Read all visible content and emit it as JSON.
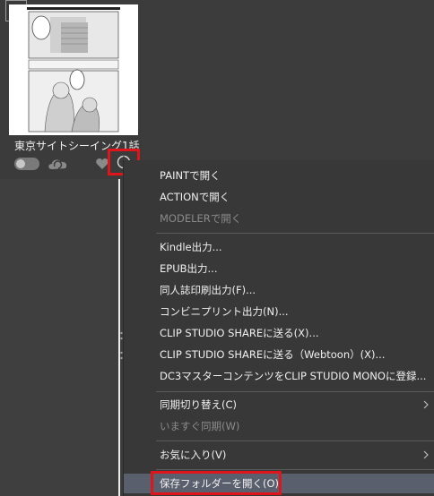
{
  "card": {
    "title": "東京サイトシーイング1話目"
  },
  "menu": {
    "items": [
      {
        "label": "PAINTで開く",
        "enabled": true
      },
      {
        "label": "ACTIONで開く",
        "enabled": true
      },
      {
        "label": "MODELERで開く",
        "enabled": false
      },
      {
        "label": "Kindle出力...",
        "enabled": true
      },
      {
        "label": "EPUB出力...",
        "enabled": true
      },
      {
        "label": "同人誌印刷出力(F)...",
        "enabled": true
      },
      {
        "label": "コンビニプリント出力(N)...",
        "enabled": true
      },
      {
        "label": "CLIP STUDIO SHAREに送る(X)...",
        "enabled": true
      },
      {
        "label": "CLIP STUDIO SHAREに送る（Webtoon）(X)...",
        "enabled": true
      },
      {
        "label": "DC3マスターコンテンツをCLIP STUDIO MONOに登録...",
        "enabled": true
      },
      {
        "label": "同期切り替え(C)",
        "enabled": true,
        "submenu": true
      },
      {
        "label": "いますぐ同期(W)",
        "enabled": false
      },
      {
        "label": "お気に入り(V)",
        "enabled": true,
        "submenu": true
      },
      {
        "label": "保存フォルダーを開く(O)",
        "enabled": true,
        "highlighted": true
      }
    ]
  },
  "colors": {
    "highlight_box": "#e0141b",
    "menu_bg": "#383838",
    "menu_hover": "#5a5f6d"
  }
}
